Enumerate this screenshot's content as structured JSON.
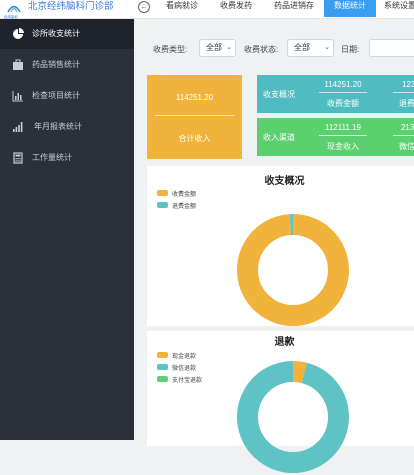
{
  "app": {
    "title": "北京经纬脑科门诊部",
    "subtitle": "经纬脑科",
    "back_icon": "arrow-left-icon"
  },
  "nav_tabs": [
    {
      "label": "看病就诊",
      "active": false
    },
    {
      "label": "收费发药",
      "active": false
    },
    {
      "label": "药品进销存",
      "active": false
    },
    {
      "label": "数据统计",
      "active": true
    },
    {
      "label": "系统设置",
      "active": false
    }
  ],
  "sidebar": {
    "items": [
      {
        "label": "诊所收支统计",
        "icon": "pie-chart-icon",
        "active": true
      },
      {
        "label": "药品销售统计",
        "icon": "briefcase-icon",
        "active": false
      },
      {
        "label": "检查项目统计",
        "icon": "bar-chart-icon",
        "active": false
      },
      {
        "label": "年月报表统计",
        "icon": "signal-bars-icon",
        "active": false
      },
      {
        "label": "工作量统计",
        "icon": "calculator-icon",
        "active": false
      }
    ]
  },
  "filters": {
    "fee_type_label": "收费类型:",
    "fee_type_value": "全部",
    "fee_status_label": "收费状态:",
    "fee_status_value": "全部",
    "date_label": "日期:",
    "date_value": ""
  },
  "summary": {
    "total_value": "114251.20",
    "total_label": "合计收入"
  },
  "overview": {
    "title": "收支概况",
    "items": [
      {
        "value": "114251.20",
        "label": "收费金额"
      },
      {
        "value": "1230",
        "label": "退费金"
      }
    ]
  },
  "channels": {
    "title": "收入渠道",
    "items": [
      {
        "value": "112111.19",
        "label": "现金收入"
      },
      {
        "value": "2130.",
        "label": "微信收"
      }
    ]
  },
  "colors": {
    "yellow": "#f2b33d",
    "teal": "#5fc3c6",
    "green": "#5ccf6e",
    "blue": "#3a9ef0",
    "sidebar": "#2b303b"
  },
  "chart_data": [
    {
      "type": "pie",
      "title": "收支概况",
      "legend_position": "top-left",
      "series": [
        {
          "name": "收费金额",
          "value": 114251.2,
          "color": "#f2b33d"
        },
        {
          "name": "退费金额",
          "value": 1230,
          "color": "#5fc3c6"
        }
      ]
    },
    {
      "type": "pie",
      "title": "退款",
      "legend_position": "top-left",
      "series": [
        {
          "name": "现金退款",
          "value": 4,
          "color": "#f2b33d"
        },
        {
          "name": "微信退款",
          "value": 96,
          "color": "#5fc3c6"
        },
        {
          "name": "支付宝退款",
          "value": 0,
          "color": "#5ccf6e"
        }
      ]
    }
  ]
}
